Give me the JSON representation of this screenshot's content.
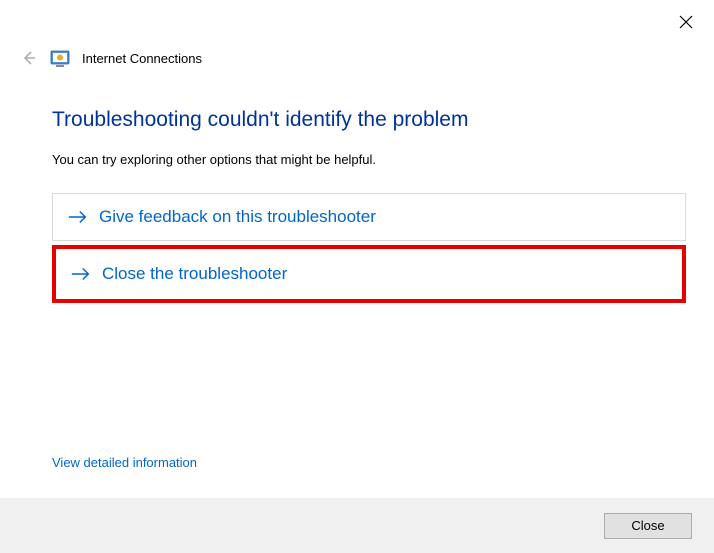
{
  "window": {
    "title": "Internet Connections"
  },
  "content": {
    "heading": "Troubleshooting couldn't identify the problem",
    "subtext": "You can try exploring other options that might be helpful."
  },
  "options": {
    "feedback": "Give feedback on this troubleshooter",
    "close": "Close the troubleshooter"
  },
  "links": {
    "detail": "View detailed information"
  },
  "footer": {
    "close_label": "Close"
  },
  "colors": {
    "link_blue": "#0066cc",
    "heading_blue": "#003399",
    "highlight_red": "#e60000"
  }
}
